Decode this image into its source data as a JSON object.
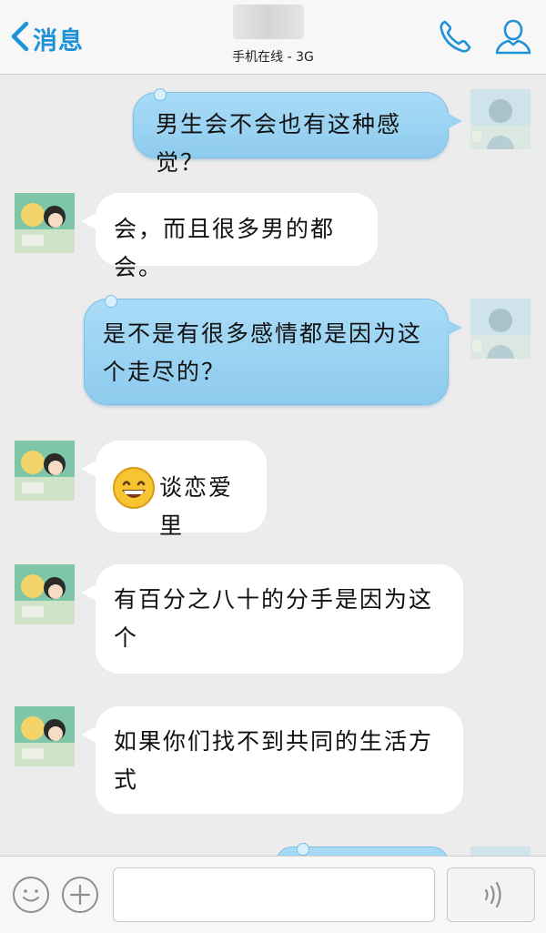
{
  "header": {
    "back_label": "消息",
    "status": "手机在线 - 3G"
  },
  "messages": [
    {
      "side": "out",
      "text": "男生会不会也有这种感觉？"
    },
    {
      "side": "in",
      "text": "会，而且很多男的都会。"
    },
    {
      "side": "out",
      "text": "是不是有很多感情都是因为这个走尽的？"
    },
    {
      "side": "in",
      "text": "谈恋爱里",
      "emoji": "grinning-face"
    },
    {
      "side": "in",
      "text": "有百分之八十的分手是因为这个"
    },
    {
      "side": "in",
      "text": "如果你们找不到共同的生活方式"
    }
  ],
  "input": {
    "value": "",
    "placeholder": ""
  },
  "colors": {
    "accent": "#1d92d6",
    "outgoing_bubble": "#a9dcf7",
    "incoming_bubble": "#ffffff",
    "background": "#ececec"
  }
}
